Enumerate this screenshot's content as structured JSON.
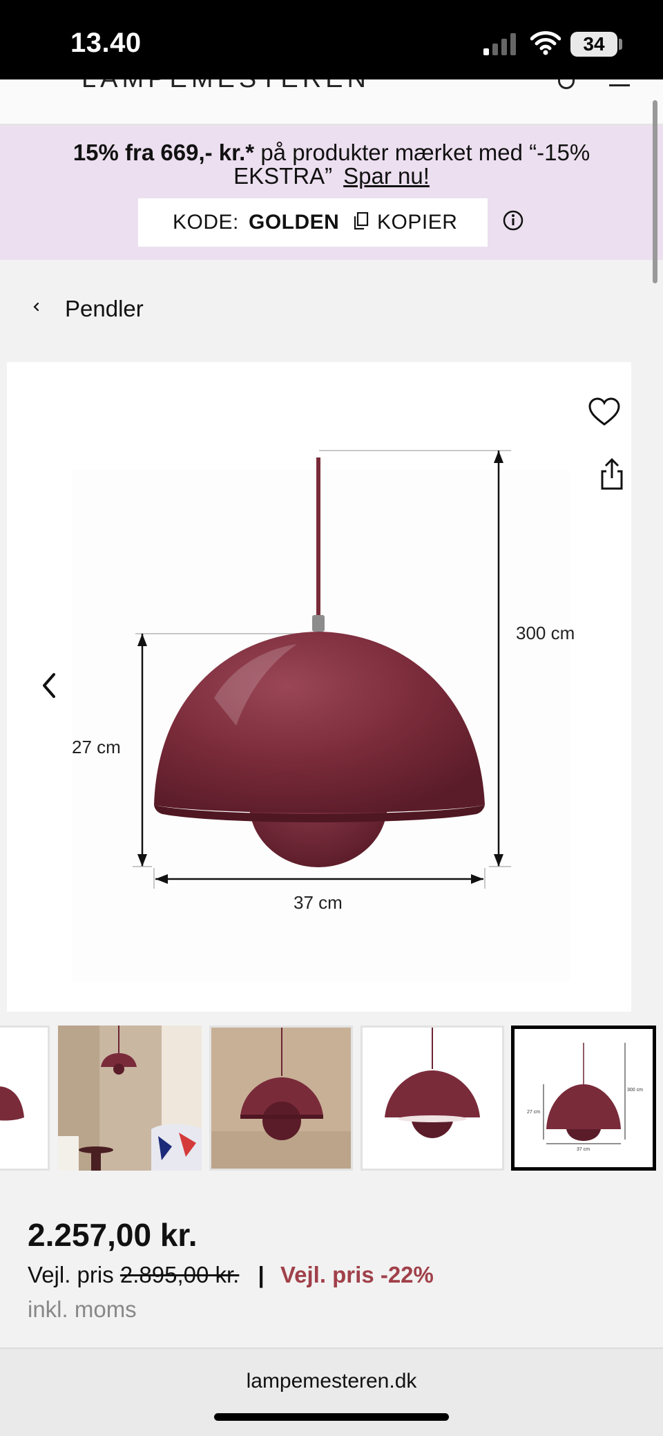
{
  "status_bar": {
    "time": "13.40",
    "battery": "34"
  },
  "site": {
    "logo": "LAMPEMESTEREN"
  },
  "promo": {
    "bold_text": "15% fra 669,- kr.*",
    "text": " på produkter mærket med “-15%",
    "text_line2": "EKSTRA”",
    "cta": "Spar nu!",
    "code_label": "KODE:",
    "code_value": "GOLDEN",
    "copy_label": "KOPIER"
  },
  "breadcrumb": {
    "label": "Pendler"
  },
  "product_image": {
    "dimension_height_total": "300 cm",
    "dimension_shade_height": "27 cm",
    "dimension_width": "37 cm",
    "shade_color": "#7a2b3a"
  },
  "thumbnails": {
    "mini_dims": {
      "height_total": "300 cm",
      "shade_height": "27 cm",
      "width": "37 cm"
    }
  },
  "price": {
    "current": "2.257,00 kr.",
    "rrp_label": "Vejl. pris",
    "rrp_value": "2.895,00 kr.",
    "separator": "|",
    "discount_label": "Vejl. pris -22%",
    "vat_note": "inkl. moms"
  },
  "browser": {
    "url": "lampemesteren.dk"
  },
  "colors": {
    "accent": "#a0404a",
    "promo_bg": "#ecdfef",
    "shade": "#7a2b3a"
  }
}
